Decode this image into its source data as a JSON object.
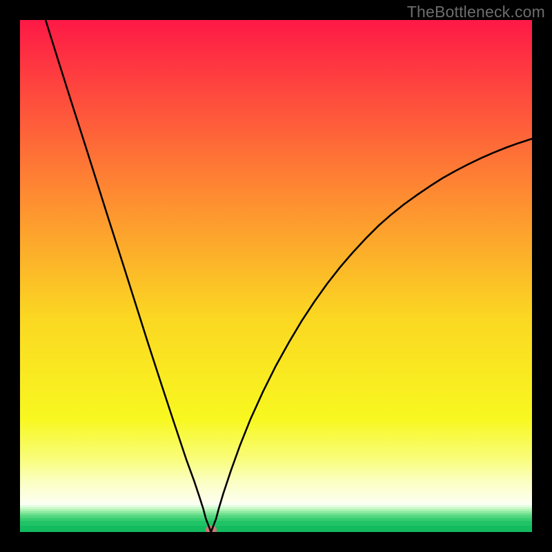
{
  "watermark": "TheBottleneck.com",
  "chart_data": {
    "type": "line",
    "title": "",
    "xlabel": "",
    "ylabel": "",
    "xlim": [
      0,
      100
    ],
    "ylim": [
      0,
      100
    ],
    "minimum_marker": {
      "x": 37.3,
      "y": 0
    },
    "series": [
      {
        "name": "curve",
        "x": [
          5.0,
          7.5,
          10.0,
          12.5,
          15.0,
          17.5,
          20.0,
          22.5,
          25.0,
          27.5,
          30.0,
          32.5,
          34.0,
          35.0,
          35.8,
          36.3,
          37.3,
          38.3,
          38.8,
          39.7,
          41.2,
          43.0,
          45.0,
          47.5,
          50.0,
          52.5,
          55.0,
          57.5,
          60.0,
          62.5,
          65.0,
          67.5,
          70.0,
          72.5,
          75.0,
          77.5,
          80.0,
          82.5,
          85.0,
          87.5,
          90.0,
          92.5,
          95.0,
          97.5,
          100.0
        ],
        "y": [
          100.0,
          92.0,
          84.1,
          76.3,
          68.4,
          60.5,
          52.7,
          44.8,
          36.9,
          29.2,
          21.6,
          14.1,
          10.0,
          7.0,
          4.5,
          2.6,
          0.0,
          2.6,
          4.5,
          7.5,
          12.0,
          17.0,
          22.0,
          27.5,
          32.5,
          37.0,
          41.2,
          45.0,
          48.5,
          51.7,
          54.6,
          57.3,
          59.8,
          62.0,
          64.0,
          65.8,
          67.5,
          69.1,
          70.5,
          71.8,
          73.0,
          74.1,
          75.1,
          76.0,
          76.8
        ]
      }
    ],
    "gradient_stops": [
      {
        "offset": 0.0,
        "color": "#fe1946"
      },
      {
        "offset": 0.32,
        "color": "#fe8433"
      },
      {
        "offset": 0.58,
        "color": "#fbd722"
      },
      {
        "offset": 0.78,
        "color": "#f8f820"
      },
      {
        "offset": 0.86,
        "color": "#f9fd7e"
      },
      {
        "offset": 0.9,
        "color": "#fbffc0"
      },
      {
        "offset": 0.942,
        "color": "#fdffee"
      }
    ],
    "green_band_top_pct": 94.3,
    "green_band": [
      {
        "color": "#f8fff5",
        "h": 3
      },
      {
        "color": "#e3fee0",
        "h": 3
      },
      {
        "color": "#c9f9c9",
        "h": 3
      },
      {
        "color": "#aaf2b3",
        "h": 3
      },
      {
        "color": "#8ae99f",
        "h": 3
      },
      {
        "color": "#6bdf8d",
        "h": 3
      },
      {
        "color": "#4fd57e",
        "h": 4
      },
      {
        "color": "#36cc71",
        "h": 4
      },
      {
        "color": "#21c367",
        "h": 7
      },
      {
        "color": "#13bb5f",
        "h": 9
      }
    ]
  }
}
